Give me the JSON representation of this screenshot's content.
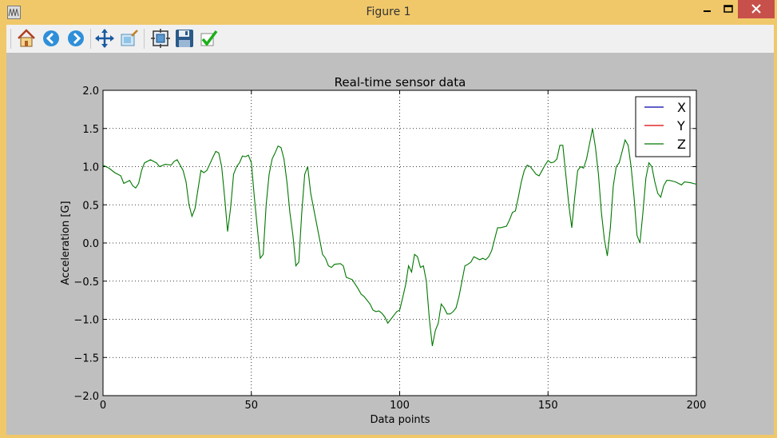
{
  "window": {
    "title": "Figure 1"
  },
  "toolbar": {
    "buttons": [
      "home-icon",
      "back-icon",
      "forward-icon",
      "pan-icon",
      "zoom-icon",
      "subplots-icon",
      "save-icon",
      "check-icon"
    ]
  },
  "chart_data": {
    "type": "line",
    "title": "Real-time sensor data",
    "xlabel": "Data points",
    "ylabel": "Acceleration [G]",
    "xlim": [
      0,
      200
    ],
    "ylim": [
      -2.0,
      2.0
    ],
    "xticks": [
      "0",
      "50",
      "100",
      "150",
      "200"
    ],
    "yticks": [
      "2.0",
      "1.5",
      "1.0",
      "0.5",
      "0.0",
      "−0.5",
      "−1.0",
      "−1.5",
      "−2.0"
    ],
    "grid": true,
    "legend_position": "top-right",
    "series": [
      {
        "name": "X",
        "color": "#0000aa",
        "points": []
      },
      {
        "name": "Y",
        "color": "#dd0000",
        "points": []
      },
      {
        "name": "Z",
        "color": "#007700",
        "points": [
          [
            0,
            1.02
          ],
          [
            2,
            0.98
          ],
          [
            4,
            0.92
          ],
          [
            6,
            0.88
          ],
          [
            7,
            0.78
          ],
          [
            9,
            0.82
          ],
          [
            10,
            0.75
          ],
          [
            11,
            0.72
          ],
          [
            12,
            0.78
          ],
          [
            13,
            0.95
          ],
          [
            14,
            1.05
          ],
          [
            16,
            1.09
          ],
          [
            18,
            1.05
          ],
          [
            19,
            1.0
          ],
          [
            21,
            1.03
          ],
          [
            23,
            1.02
          ],
          [
            24,
            1.07
          ],
          [
            25,
            1.09
          ],
          [
            27,
            0.95
          ],
          [
            28,
            0.8
          ],
          [
            29,
            0.5
          ],
          [
            30,
            0.35
          ],
          [
            31,
            0.45
          ],
          [
            33,
            0.95
          ],
          [
            34,
            0.92
          ],
          [
            35,
            0.95
          ],
          [
            37,
            1.12
          ],
          [
            38,
            1.2
          ],
          [
            39,
            1.18
          ],
          [
            40,
            1.0
          ],
          [
            41,
            0.6
          ],
          [
            42,
            0.15
          ],
          [
            43,
            0.45
          ],
          [
            44,
            0.9
          ],
          [
            45,
            1.0
          ],
          [
            46,
            1.05
          ],
          [
            47,
            1.14
          ],
          [
            48,
            1.13
          ],
          [
            49,
            1.15
          ],
          [
            50,
            1.05
          ],
          [
            51,
            0.6
          ],
          [
            52,
            0.2
          ],
          [
            53,
            -0.2
          ],
          [
            54,
            -0.15
          ],
          [
            55,
            0.5
          ],
          [
            56,
            0.9
          ],
          [
            57,
            1.1
          ],
          [
            58,
            1.18
          ],
          [
            59,
            1.27
          ],
          [
            60,
            1.25
          ],
          [
            61,
            1.1
          ],
          [
            62,
            0.8
          ],
          [
            63,
            0.4
          ],
          [
            64,
            0.1
          ],
          [
            65,
            -0.3
          ],
          [
            66,
            -0.25
          ],
          [
            67,
            0.4
          ],
          [
            68,
            0.9
          ],
          [
            69,
            1.0
          ],
          [
            70,
            0.65
          ],
          [
            72,
            0.25
          ],
          [
            74,
            -0.15
          ],
          [
            75,
            -0.2
          ],
          [
            76,
            -0.3
          ],
          [
            77,
            -0.32
          ],
          [
            78,
            -0.28
          ],
          [
            80,
            -0.27
          ],
          [
            81,
            -0.3
          ],
          [
            82,
            -0.45
          ],
          [
            84,
            -0.48
          ],
          [
            86,
            -0.6
          ],
          [
            87,
            -0.67
          ],
          [
            88,
            -0.7
          ],
          [
            90,
            -0.8
          ],
          [
            91,
            -0.88
          ],
          [
            92,
            -0.9
          ],
          [
            93,
            -0.89
          ],
          [
            94,
            -0.92
          ],
          [
            95,
            -0.97
          ],
          [
            96,
            -1.05
          ],
          [
            97,
            -1.0
          ],
          [
            98,
            -0.95
          ],
          [
            99,
            -0.9
          ],
          [
            100,
            -0.88
          ],
          [
            101,
            -0.72
          ],
          [
            102,
            -0.55
          ],
          [
            103,
            -0.3
          ],
          [
            104,
            -0.38
          ],
          [
            105,
            -0.15
          ],
          [
            106,
            -0.18
          ],
          [
            107,
            -0.32
          ],
          [
            108,
            -0.3
          ],
          [
            109,
            -0.5
          ],
          [
            110,
            -1.0
          ],
          [
            111,
            -1.35
          ],
          [
            112,
            -1.15
          ],
          [
            113,
            -1.05
          ],
          [
            114,
            -0.8
          ],
          [
            115,
            -0.85
          ],
          [
            116,
            -0.93
          ],
          [
            117,
            -0.93
          ],
          [
            118,
            -0.9
          ],
          [
            119,
            -0.85
          ],
          [
            120,
            -0.7
          ],
          [
            121,
            -0.5
          ],
          [
            122,
            -0.3
          ],
          [
            123,
            -0.28
          ],
          [
            124,
            -0.25
          ],
          [
            125,
            -0.18
          ],
          [
            126,
            -0.2
          ],
          [
            127,
            -0.22
          ],
          [
            128,
            -0.2
          ],
          [
            129,
            -0.22
          ],
          [
            130,
            -0.18
          ],
          [
            131,
            -0.1
          ],
          [
            132,
            0.05
          ],
          [
            133,
            0.2
          ],
          [
            134,
            0.2
          ],
          [
            136,
            0.22
          ],
          [
            137,
            0.3
          ],
          [
            138,
            0.4
          ],
          [
            139,
            0.42
          ],
          [
            140,
            0.6
          ],
          [
            141,
            0.8
          ],
          [
            142,
            0.95
          ],
          [
            143,
            1.02
          ],
          [
            144,
            1.0
          ],
          [
            145,
            0.95
          ],
          [
            146,
            0.9
          ],
          [
            147,
            0.88
          ],
          [
            148,
            0.95
          ],
          [
            149,
            1.02
          ],
          [
            150,
            1.08
          ],
          [
            151,
            1.05
          ],
          [
            152,
            1.06
          ],
          [
            153,
            1.1
          ],
          [
            154,
            1.28
          ],
          [
            155,
            1.28
          ],
          [
            156,
            0.9
          ],
          [
            157,
            0.5
          ],
          [
            158,
            0.2
          ],
          [
            159,
            0.6
          ],
          [
            160,
            0.95
          ],
          [
            161,
            1.0
          ],
          [
            162,
            0.98
          ],
          [
            163,
            1.1
          ],
          [
            164,
            1.3
          ],
          [
            165,
            1.5
          ],
          [
            166,
            1.25
          ],
          [
            167,
            0.9
          ],
          [
            168,
            0.4
          ],
          [
            169,
            0.05
          ],
          [
            170,
            -0.17
          ],
          [
            171,
            0.2
          ],
          [
            172,
            0.75
          ],
          [
            173,
            1.0
          ],
          [
            174,
            1.05
          ],
          [
            175,
            1.2
          ],
          [
            176,
            1.35
          ],
          [
            177,
            1.28
          ],
          [
            178,
            1.0
          ],
          [
            179,
            0.6
          ],
          [
            180,
            0.1
          ],
          [
            181,
            0.0
          ],
          [
            182,
            0.4
          ],
          [
            183,
            0.85
          ],
          [
            184,
            1.05
          ],
          [
            185,
            1.0
          ],
          [
            186,
            0.8
          ],
          [
            187,
            0.65
          ],
          [
            188,
            0.6
          ],
          [
            189,
            0.75
          ],
          [
            190,
            0.82
          ],
          [
            191,
            0.82
          ],
          [
            192,
            0.81
          ],
          [
            193,
            0.8
          ],
          [
            194,
            0.78
          ],
          [
            195,
            0.76
          ],
          [
            196,
            0.8
          ],
          [
            198,
            0.79
          ],
          [
            200,
            0.77
          ]
        ]
      }
    ]
  }
}
